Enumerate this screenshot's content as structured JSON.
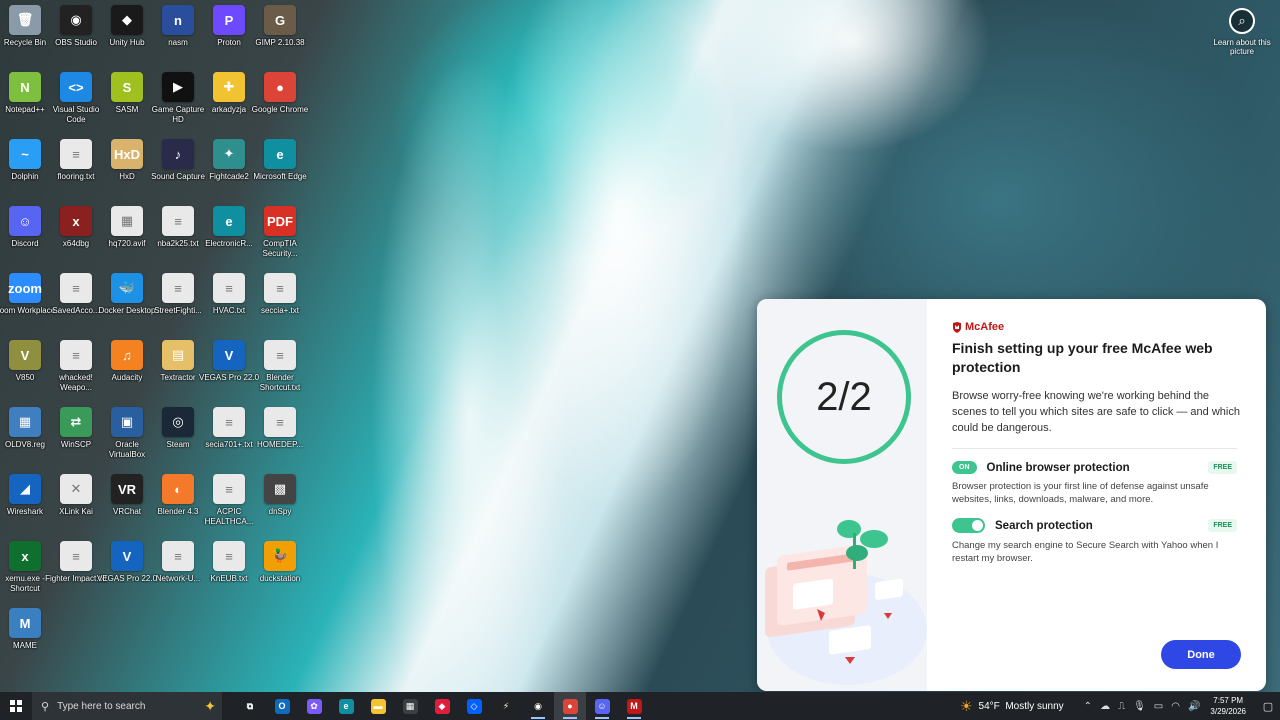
{
  "desktop": {
    "icons": [
      {
        "label": "Recycle Bin",
        "glyph": "🗑",
        "color": "#8a9aa6"
      },
      {
        "label": "OBS Studio",
        "glyph": "◉",
        "color": "#222222"
      },
      {
        "label": "Unity Hub",
        "glyph": "◆",
        "color": "#1a1a1a"
      },
      {
        "label": "nasm",
        "glyph": "n",
        "color": "#2a4d9c"
      },
      {
        "label": "Proton",
        "glyph": "P",
        "color": "#6d4aff"
      },
      {
        "label": "GIMP 2.10.38",
        "glyph": "G",
        "color": "#6b5c49"
      },
      {
        "label": "Notepad++",
        "glyph": "N",
        "color": "#7fbf3f"
      },
      {
        "label": "Visual Studio Code",
        "glyph": "<>",
        "color": "#1e88e5"
      },
      {
        "label": "SASM",
        "glyph": "S",
        "color": "#a0c020"
      },
      {
        "label": "Game Capture HD",
        "glyph": "▶",
        "color": "#111111"
      },
      {
        "label": "arkadyzja",
        "glyph": "✚",
        "color": "#f1c232"
      },
      {
        "label": "Google Chrome",
        "glyph": "●",
        "color": "#db4437"
      },
      {
        "label": "Dolphin",
        "glyph": "~",
        "color": "#2a9df4"
      },
      {
        "label": "flooring.txt",
        "glyph": "≡",
        "color": "#e9e9e9"
      },
      {
        "label": "HxD",
        "glyph": "HxD",
        "color": "#d9b36c"
      },
      {
        "label": "Sound Capture",
        "glyph": "♪",
        "color": "#2a2a4a"
      },
      {
        "label": "Fightcade2",
        "glyph": "✦",
        "color": "#2f8f8f"
      },
      {
        "label": "Microsoft Edge",
        "glyph": "e",
        "color": "#0f8f9f"
      },
      {
        "label": "Discord",
        "glyph": "☺",
        "color": "#5865f2"
      },
      {
        "label": "x64dbg",
        "glyph": "x",
        "color": "#8a2020"
      },
      {
        "label": "hq720.avif",
        "glyph": "▦",
        "color": "#e9e9e9"
      },
      {
        "label": "nba2k25.txt",
        "glyph": "≡",
        "color": "#e9e9e9"
      },
      {
        "label": "ElectronicR...",
        "glyph": "e",
        "color": "#0f8f9f"
      },
      {
        "label": "CompTIA Security...",
        "glyph": "PDF",
        "color": "#d93025"
      },
      {
        "label": "Zoom Workplace",
        "glyph": "zoom",
        "color": "#2d8cff"
      },
      {
        "label": "SavedAcco...",
        "glyph": "≡",
        "color": "#e9e9e9"
      },
      {
        "label": "Docker Desktop",
        "glyph": "🐳",
        "color": "#1d91e6"
      },
      {
        "label": "StreetFighti...",
        "glyph": "≡",
        "color": "#e9e9e9"
      },
      {
        "label": "HVAC.txt",
        "glyph": "≡",
        "color": "#e9e9e9"
      },
      {
        "label": "seccia+.txt",
        "glyph": "≡",
        "color": "#e9e9e9"
      },
      {
        "label": "V850",
        "glyph": "V",
        "color": "#8f8f3f"
      },
      {
        "label": "whacked! Weapo...",
        "glyph": "≡",
        "color": "#e9e9e9"
      },
      {
        "label": "Audacity",
        "glyph": "♫",
        "color": "#f58220"
      },
      {
        "label": "Textractor",
        "glyph": "▤",
        "color": "#e6c069"
      },
      {
        "label": "VEGAS Pro 22.0",
        "glyph": "V",
        "color": "#1565c0"
      },
      {
        "label": "Blender Shortcut.txt",
        "glyph": "≡",
        "color": "#e9e9e9"
      },
      {
        "label": "OLDV8.reg",
        "glyph": "▦",
        "color": "#3f7fbf"
      },
      {
        "label": "WinSCP",
        "glyph": "⇄",
        "color": "#3a9a5a"
      },
      {
        "label": "Oracle VirtualBox",
        "glyph": "▣",
        "color": "#2a5f9f"
      },
      {
        "label": "Steam",
        "glyph": "◎",
        "color": "#1b2838"
      },
      {
        "label": "secia701+.txt",
        "glyph": "≡",
        "color": "#e9e9e9"
      },
      {
        "label": "HOMEDEP...",
        "glyph": "≡",
        "color": "#e9e9e9"
      },
      {
        "label": "Wireshark",
        "glyph": "◢",
        "color": "#1565c0"
      },
      {
        "label": "XLink Kai",
        "glyph": "✕",
        "color": "#e9e9e9"
      },
      {
        "label": "VRChat",
        "glyph": "VR",
        "color": "#222222"
      },
      {
        "label": "Blender 4.3",
        "glyph": "◐",
        "color": "#f5792a"
      },
      {
        "label": "ACPIC HEALTHCA...",
        "glyph": "≡",
        "color": "#e9e9e9"
      },
      {
        "label": "dnSpy",
        "glyph": "▩",
        "color": "#444444"
      },
      {
        "label": "xemu.exe - Shortcut",
        "glyph": "x",
        "color": "#0f6f2f"
      },
      {
        "label": "Fighter Impact.txt",
        "glyph": "≡",
        "color": "#e9e9e9"
      },
      {
        "label": "VEGAS Pro 22.0",
        "glyph": "V",
        "color": "#1565c0"
      },
      {
        "label": "Network-U...",
        "glyph": "≡",
        "color": "#e9e9e9"
      },
      {
        "label": "KnEUB.txt",
        "glyph": "≡",
        "color": "#e9e9e9"
      },
      {
        "label": "duckstation",
        "glyph": "🦆",
        "color": "#f29f05"
      },
      {
        "label": "MAME",
        "glyph": "M",
        "color": "#3a7fbf"
      }
    ]
  },
  "learn_more": {
    "label": "Learn about this picture"
  },
  "popup": {
    "progress": "2/2",
    "brand": "McAfee",
    "title": "Finish setting up your free McAfee web protection",
    "description": "Browse worry-free knowing we're working behind the scenes to tell you which sites are safe to click — and which could be dangerous.",
    "options": [
      {
        "state": "ON",
        "title": "Online browser protection",
        "badge": "FREE",
        "description": "Browser protection is your first line of defense against unsafe websites, links, downloads, malware, and more."
      },
      {
        "state": "toggle-on",
        "title": "Search protection",
        "badge": "FREE",
        "description": "Change my search engine to Secure Search with Yahoo when I restart my browser."
      }
    ],
    "done_label": "Done"
  },
  "taskbar": {
    "search_placeholder": "Type here to search",
    "apps": [
      {
        "name": "task-view",
        "glyph": "⧉",
        "color": "transparent"
      },
      {
        "name": "outlook",
        "glyph": "O",
        "color": "#0f6cbd"
      },
      {
        "name": "copilot",
        "glyph": "✿",
        "color": "#7a5af8"
      },
      {
        "name": "edge",
        "glyph": "e",
        "color": "#0f8f9f"
      },
      {
        "name": "file-explorer",
        "glyph": "▬",
        "color": "#f4c430"
      },
      {
        "name": "microsoft-store",
        "glyph": "▦",
        "color": "#3a3f44"
      },
      {
        "name": "red-diamond-app",
        "glyph": "◆",
        "color": "#e01e3c"
      },
      {
        "name": "dropbox",
        "glyph": "◇",
        "color": "#0061fe"
      },
      {
        "name": "lightning-app",
        "glyph": "⚡",
        "color": "#222222"
      },
      {
        "name": "obs",
        "glyph": "◉",
        "color": "#222222"
      },
      {
        "name": "chrome",
        "glyph": "●",
        "color": "#db4437"
      },
      {
        "name": "discord-browser",
        "glyph": "☺",
        "color": "#5865f2"
      },
      {
        "name": "mcafee",
        "glyph": "M",
        "color": "#c01818"
      }
    ],
    "weather": {
      "temp": "54°F",
      "condition": "Mostly sunny"
    },
    "time": "7:57 PM",
    "date": "3/29/2026"
  }
}
